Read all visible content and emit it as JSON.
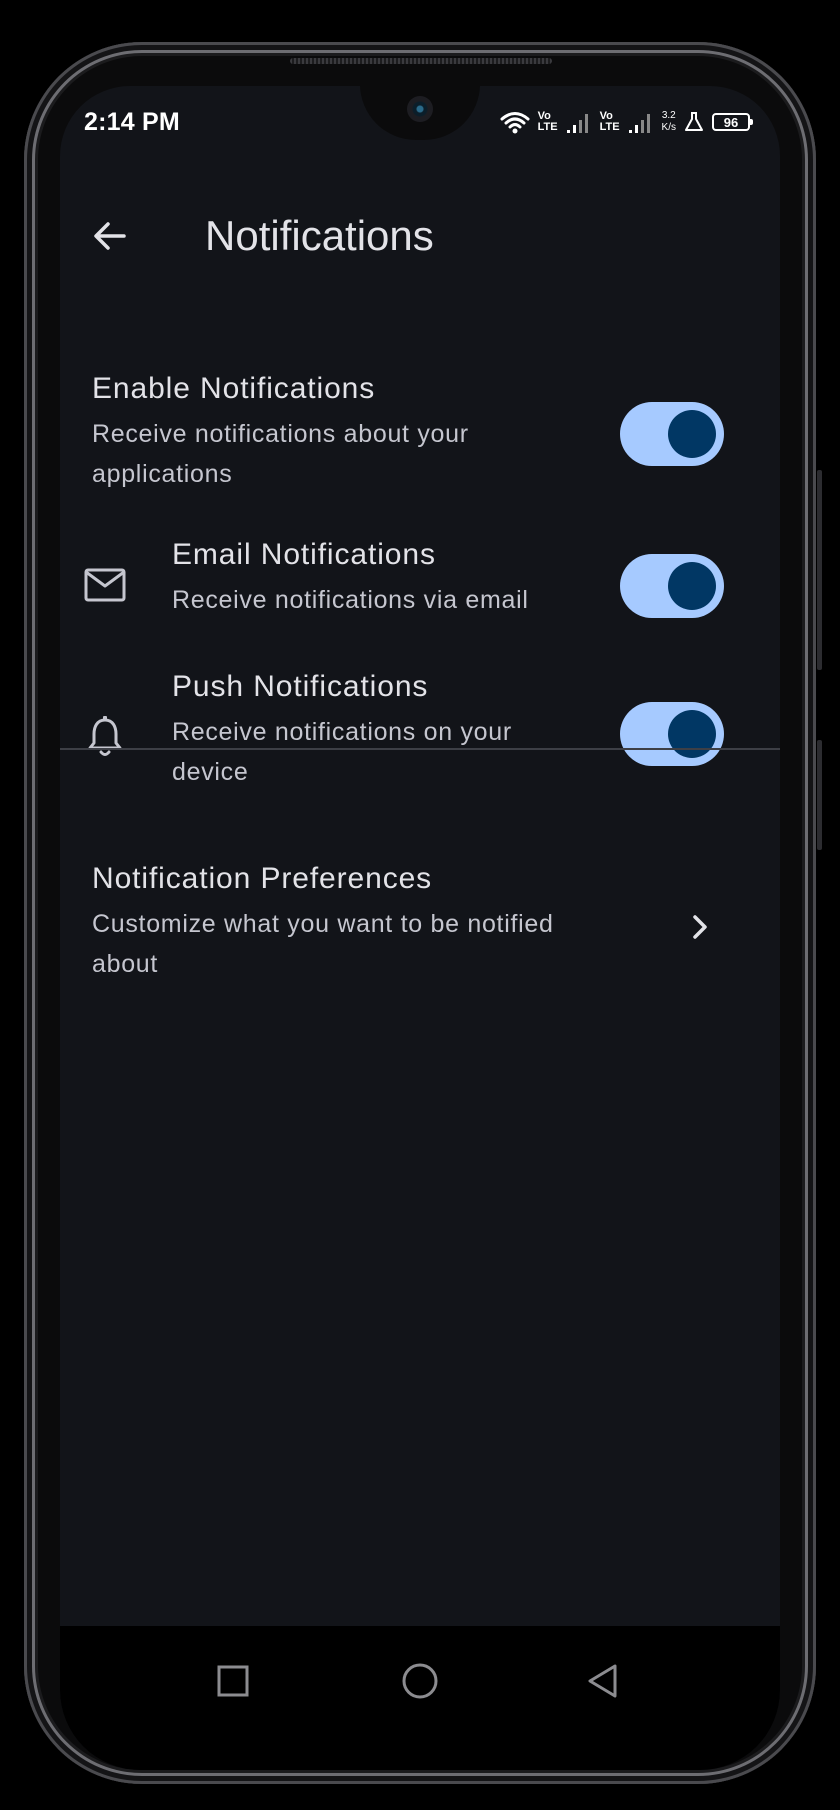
{
  "status_bar": {
    "time": "2:14 PM",
    "vo": "Vo",
    "lte": "LTE",
    "speed_value": "3.2",
    "speed_unit": "K/s",
    "battery": "96"
  },
  "app_bar": {
    "title": "Notifications"
  },
  "settings": [
    {
      "title": "Enable Notifications",
      "subtitle": "Receive notifications about your applications",
      "enabled": true
    },
    {
      "title": "Email Notifications",
      "subtitle": "Receive notifications via email",
      "icon": "mail-icon",
      "enabled": true
    },
    {
      "title": "Push Notifications",
      "subtitle": "Receive notifications on your device",
      "icon": "bell-icon",
      "enabled": true
    }
  ],
  "preferences": {
    "title": "Notification Preferences",
    "subtitle": "Customize what you want to be notified about"
  },
  "colors": {
    "background": "#121419",
    "toggle_track": "#a6caff",
    "toggle_knob": "#013764",
    "primary_text": "#e3e3e8",
    "secondary_text": "#c5c6cf"
  }
}
